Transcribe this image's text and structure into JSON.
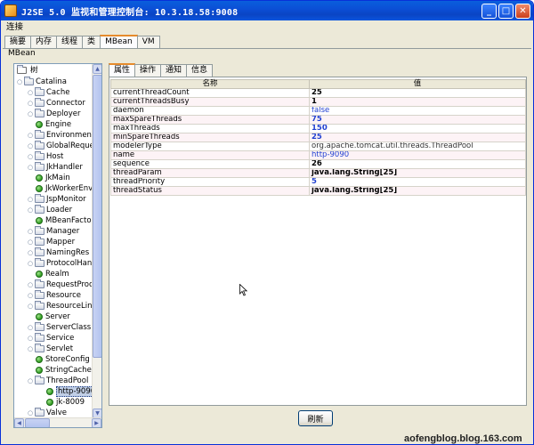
{
  "window": {
    "title": "J2SE 5.0 监视和管理控制台: 10.3.18.58:9008",
    "controls": {
      "minimize": "_",
      "maximize": "□",
      "close": "✕"
    }
  },
  "menu": [
    "连接"
  ],
  "main_tabs": [
    "摘要",
    "内存",
    "线程",
    "类",
    "MBean",
    "VM"
  ],
  "main_tabs_active": "MBean",
  "section_label": "MBean",
  "tree": {
    "root": "树",
    "node": "Catalina",
    "items": [
      {
        "label": "Cache",
        "type": "folder"
      },
      {
        "label": "Connector",
        "type": "folder"
      },
      {
        "label": "Deployer",
        "type": "folder"
      },
      {
        "label": "Engine",
        "type": "bean"
      },
      {
        "label": "Environment",
        "type": "folder"
      },
      {
        "label": "GlobalReque",
        "type": "folder"
      },
      {
        "label": "Host",
        "type": "folder"
      },
      {
        "label": "JkHandler",
        "type": "folder"
      },
      {
        "label": "JkMain",
        "type": "bean"
      },
      {
        "label": "JkWorkerEnv",
        "type": "bean"
      },
      {
        "label": "JspMonitor",
        "type": "folder"
      },
      {
        "label": "Loader",
        "type": "folder"
      },
      {
        "label": "MBeanFacto",
        "type": "bean"
      },
      {
        "label": "Manager",
        "type": "folder"
      },
      {
        "label": "Mapper",
        "type": "folder"
      },
      {
        "label": "NamingRes",
        "type": "folder"
      },
      {
        "label": "ProtocolHan",
        "type": "folder"
      },
      {
        "label": "Realm",
        "type": "bean"
      },
      {
        "label": "RequestProc",
        "type": "folder"
      },
      {
        "label": "Resource",
        "type": "folder"
      },
      {
        "label": "ResourceLin",
        "type": "folder"
      },
      {
        "label": "Server",
        "type": "bean"
      },
      {
        "label": "ServerClass",
        "type": "folder"
      },
      {
        "label": "Service",
        "type": "folder"
      },
      {
        "label": "Servlet",
        "type": "folder"
      },
      {
        "label": "StoreConfig",
        "type": "bean"
      },
      {
        "label": "StringCache",
        "type": "bean"
      },
      {
        "label": "ThreadPool",
        "type": "folder"
      },
      {
        "label": "http-9090",
        "type": "bean",
        "child": true,
        "selected": true
      },
      {
        "label": "jk-8009",
        "type": "bean",
        "child": true
      },
      {
        "label": "Valve",
        "type": "folder"
      }
    ]
  },
  "sub_tabs": [
    "属性",
    "操作",
    "通知",
    "信息"
  ],
  "sub_tabs_active": "属性",
  "table": {
    "headers": [
      "名称",
      "值"
    ],
    "rows": [
      {
        "name": "currentThreadCount",
        "value": "25",
        "style": "bold"
      },
      {
        "name": "currentThreadsBusy",
        "value": "1",
        "style": "bold"
      },
      {
        "name": "daemon",
        "value": "false",
        "style": "blue"
      },
      {
        "name": "maxSpareThreads",
        "value": "75",
        "style": "bold-blue"
      },
      {
        "name": "maxThreads",
        "value": "150",
        "style": "bold-blue"
      },
      {
        "name": "minSpareThreads",
        "value": "25",
        "style": "bold-blue"
      },
      {
        "name": "modelerType",
        "value": "org.apache.tomcat.util.threads.ThreadPool",
        "style": "gray"
      },
      {
        "name": "name",
        "value": "http-9090",
        "style": "blue"
      },
      {
        "name": "sequence",
        "value": "26",
        "style": "bold"
      },
      {
        "name": "threadParam",
        "value": "java.lang.String[25]",
        "style": "bold"
      },
      {
        "name": "threadPriority",
        "value": "5",
        "style": "bold-blue"
      },
      {
        "name": "threadStatus",
        "value": "java.lang.String[25]",
        "style": "bold"
      }
    ]
  },
  "refresh_label": "刷新",
  "watermark": "aofengblog.blog.163.com",
  "colors": {
    "titlebar": "#0a5fdc",
    "active_tab_accent": "#e68b2c",
    "value_blue": "#1f3fd1",
    "row_alt": "#fdf3f6"
  }
}
